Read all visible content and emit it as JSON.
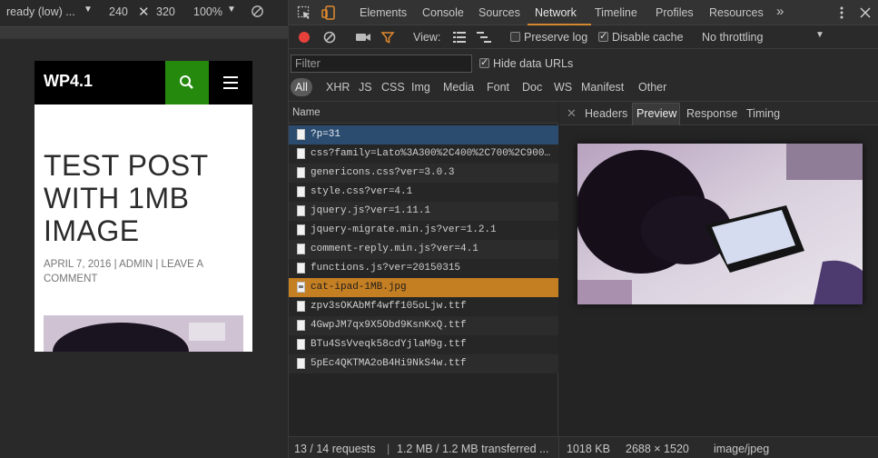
{
  "device_bar": {
    "device": "ready (low) ...",
    "width": "240",
    "height": "320",
    "zoom": "100%"
  },
  "page": {
    "site_title": "WP4.1",
    "post_title": "TEST POST WITH 1MB IMAGE",
    "post_meta": "APRIL 7, 2016 | ADMIN | LEAVE A COMMENT"
  },
  "devtools": {
    "tabs": [
      "Elements",
      "Console",
      "Sources",
      "Network",
      "Timeline",
      "Profiles",
      "Resources"
    ],
    "more_tabs": "»",
    "toolbar": {
      "view_label": "View:",
      "preserve_log": "Preserve log",
      "disable_cache": "Disable cache",
      "throttling": "No throttling"
    },
    "filter": {
      "placeholder": "Filter",
      "hide_data_urls": "Hide data URLs",
      "types": [
        "All",
        "XHR",
        "JS",
        "CSS",
        "Img",
        "Media",
        "Font",
        "Doc",
        "WS",
        "Manifest",
        "Other"
      ]
    },
    "list_header": "Name",
    "requests": [
      {
        "name": "?p=31"
      },
      {
        "name": "css?family=Lato%3A300%2C400%2C700%2C900..."
      },
      {
        "name": "genericons.css?ver=3.0.3"
      },
      {
        "name": "style.css?ver=4.1"
      },
      {
        "name": "jquery.js?ver=1.11.1"
      },
      {
        "name": "jquery-migrate.min.js?ver=1.2.1"
      },
      {
        "name": "comment-reply.min.js?ver=4.1"
      },
      {
        "name": "functions.js?ver=20150315"
      },
      {
        "name": "cat-ipad-1MB.jpg"
      },
      {
        "name": "zpv3sOKAbMf4wff105oLjw.ttf"
      },
      {
        "name": "4GwpJM7qx9X5Obd9KsnKxQ.ttf"
      },
      {
        "name": "BTu4SsVveqk58cdYjlaM9g.ttf"
      },
      {
        "name": "5pEc4QKTMA2oB4Hi9NkS4w.ttf"
      }
    ],
    "preview_tabs": [
      "Headers",
      "Preview",
      "Response",
      "Timing"
    ],
    "status": {
      "requests": "13 / 14 requests",
      "transferred": "1.2 MB / 1.2 MB transferred ...",
      "size": "1018 KB",
      "dimensions": "2688 × 1520",
      "mime": "image/jpeg"
    }
  },
  "colors": {
    "accent_orange": "#d4872f",
    "selected_blue": "#2b4c6f",
    "search_green": "#24890d"
  }
}
